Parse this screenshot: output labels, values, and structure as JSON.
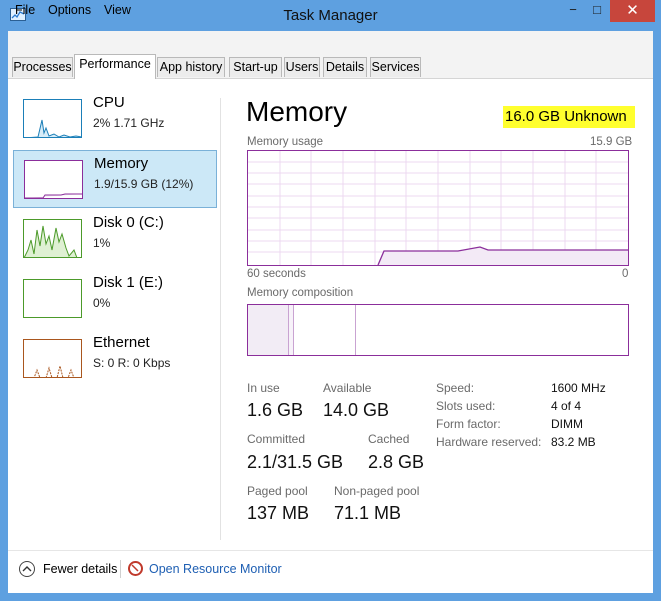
{
  "window": {
    "title": "Task Manager",
    "minimize_glyph": "−",
    "maximize_glyph": "□",
    "close_glyph": "✕"
  },
  "menu": [
    "File",
    "Options",
    "View"
  ],
  "tabs": [
    "Processes",
    "Performance",
    "App history",
    "Start-up",
    "Users",
    "Details",
    "Services"
  ],
  "active_tab": "Performance",
  "sidebar": {
    "items": [
      {
        "title": "CPU",
        "subtitle": "2%  1.71 GHz",
        "color": "#1b7fb8",
        "icon": "cpu-graph-icon"
      },
      {
        "title": "Memory",
        "subtitle": "1.9/15.9 GB (12%)",
        "color": "#8b2e9b",
        "icon": "memory-graph-icon"
      },
      {
        "title": "Disk 0 (C:)",
        "subtitle": "1%",
        "color": "#4c9a2a",
        "icon": "disk-graph-icon"
      },
      {
        "title": "Disk 1 (E:)",
        "subtitle": "0%",
        "color": "#4c9a2a",
        "icon": "disk-graph-icon"
      },
      {
        "title": "Ethernet",
        "subtitle": "S: 0  R: 0 Kbps",
        "color": "#a9561e",
        "icon": "ethernet-graph-icon"
      }
    ],
    "selected": "Memory"
  },
  "main": {
    "title": "Memory",
    "total": "16.0 GB Unknown",
    "usage_label": "Memory usage",
    "usage_max": "15.9 GB",
    "time_left": "60 seconds",
    "time_right": "0",
    "composition_label": "Memory composition",
    "accent": "#8b2e9b",
    "highlight_color": "#ffff2e",
    "stats": {
      "in_use_label": "In use",
      "in_use": "1.6 GB",
      "available_label": "Available",
      "available": "14.0 GB",
      "committed_label": "Committed",
      "committed": "2.1/31.5 GB",
      "cached_label": "Cached",
      "cached": "2.8 GB",
      "paged_label": "Paged pool",
      "paged": "137 MB",
      "nonpaged_label": "Non-paged pool",
      "nonpaged": "71.1 MB"
    },
    "specs": [
      {
        "label": "Speed:",
        "value": "1600 MHz"
      },
      {
        "label": "Slots used:",
        "value": "4 of 4"
      },
      {
        "label": "Form factor:",
        "value": "DIMM"
      },
      {
        "label": "Hardware reserved:",
        "value": "83.2 MB"
      }
    ]
  },
  "footer": {
    "fewer_details": "Fewer details",
    "open_resource_monitor": "Open Resource Monitor"
  }
}
